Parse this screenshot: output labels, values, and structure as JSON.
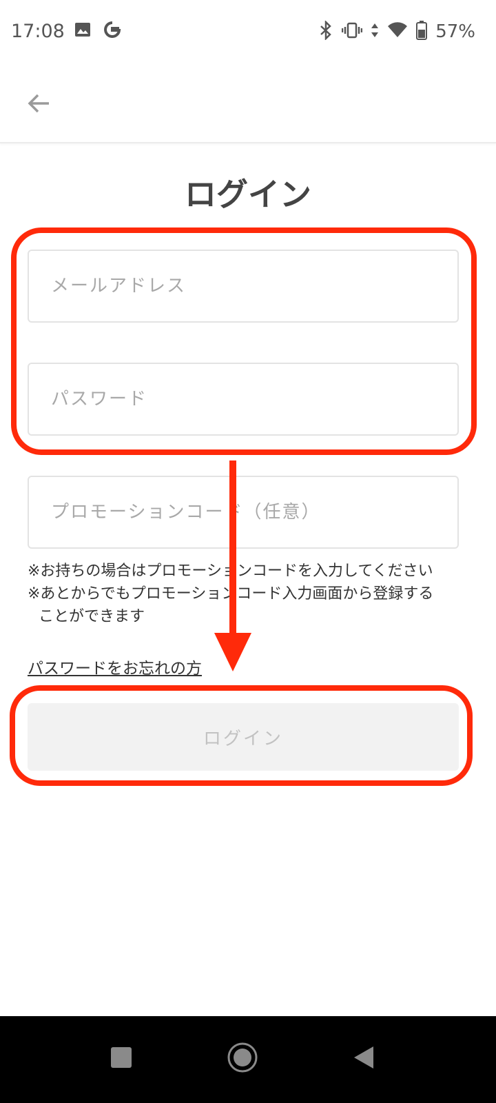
{
  "status_bar": {
    "time": "17:08",
    "battery": "57%",
    "icons_left": [
      "image-icon",
      "google-icon"
    ],
    "icons_right": [
      "bluetooth-icon",
      "vibrate-icon",
      "data-icon",
      "wifi-icon",
      "battery-icon"
    ]
  },
  "app_bar": {
    "back_icon": "arrow-left-icon"
  },
  "page": {
    "title": "ログイン"
  },
  "form": {
    "email_placeholder": "メールアドレス",
    "password_placeholder": "パスワード",
    "promo_placeholder": "プロモーションコード（任意）",
    "notes": [
      "※お持ちの場合はプロモーションコードを入力してください",
      "※あとからでもプロモーションコード入力画面から登録する",
      "ことができます"
    ],
    "forgot_password": "パスワードをお忘れの方",
    "login_button": "ログイン"
  },
  "nav_bar": {
    "buttons": [
      "recents-icon",
      "home-icon",
      "back-icon"
    ]
  },
  "colors": {
    "annotation": "#ff2a0a",
    "button_bg": "#f2f2f2",
    "text": "#444444"
  }
}
